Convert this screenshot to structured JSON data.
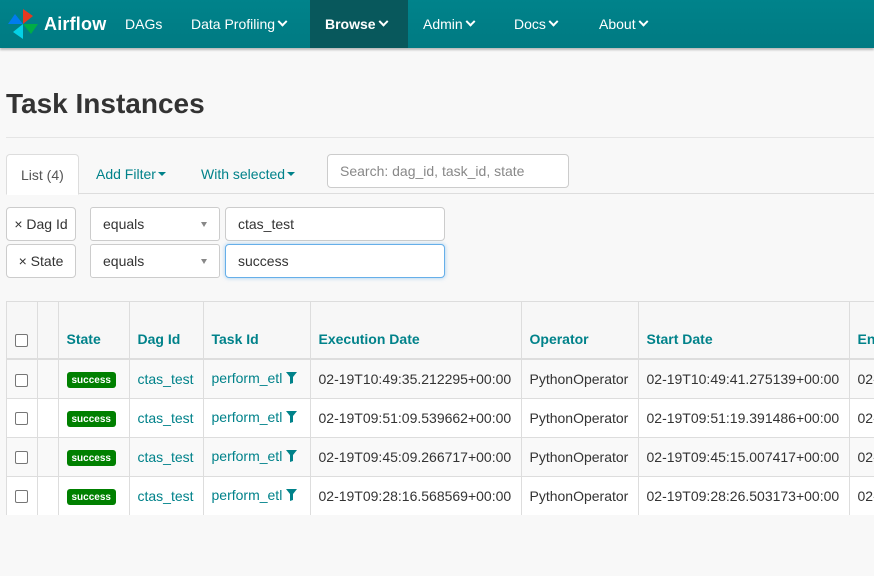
{
  "navbar": {
    "brand": "Airflow",
    "items": [
      {
        "label": "DAGs",
        "dropdown": false,
        "active": false
      },
      {
        "label": "Data Profiling",
        "dropdown": true,
        "active": false
      },
      {
        "label": "Browse",
        "dropdown": true,
        "active": true
      },
      {
        "label": "Admin",
        "dropdown": true,
        "active": false
      },
      {
        "label": "Docs",
        "dropdown": true,
        "active": false
      },
      {
        "label": "About",
        "dropdown": true,
        "active": false
      }
    ]
  },
  "page": {
    "title": "Task Instances"
  },
  "tabs": {
    "list": "List (4)",
    "add_filter": "Add Filter",
    "with_selected": "With selected"
  },
  "search": {
    "placeholder": "Search: dag_id, task_id, state",
    "value": ""
  },
  "filters": [
    {
      "remove_label": "× Dag Id",
      "operator": "equals",
      "value": "ctas_test"
    },
    {
      "remove_label": "× State",
      "operator": "equals",
      "value": "success"
    }
  ],
  "table": {
    "columns": [
      "State",
      "Dag Id",
      "Task Id",
      "Execution Date",
      "Operator",
      "Start Date",
      "En"
    ],
    "rows": [
      {
        "state": "success",
        "dag_id": "ctas_test",
        "task_id": "perform_etl",
        "execution_date": "02-19T10:49:35.212295+00:00",
        "operator": "PythonOperator",
        "start_date": "02-19T10:49:41.275139+00:00",
        "end_date": "02-"
      },
      {
        "state": "success",
        "dag_id": "ctas_test",
        "task_id": "perform_etl",
        "execution_date": "02-19T09:51:09.539662+00:00",
        "operator": "PythonOperator",
        "start_date": "02-19T09:51:19.391486+00:00",
        "end_date": "02-"
      },
      {
        "state": "success",
        "dag_id": "ctas_test",
        "task_id": "perform_etl",
        "execution_date": "02-19T09:45:09.266717+00:00",
        "operator": "PythonOperator",
        "start_date": "02-19T09:45:15.007417+00:00",
        "end_date": "02-"
      },
      {
        "state": "success",
        "dag_id": "ctas_test",
        "task_id": "perform_etl",
        "execution_date": "02-19T09:28:16.568569+00:00",
        "operator": "PythonOperator",
        "start_date": "02-19T09:28:26.503173+00:00",
        "end_date": "02-"
      }
    ]
  },
  "colors": {
    "navbar": "#00838b",
    "navbar_active": "#08585c",
    "link": "#00828a",
    "success_badge": "#008000"
  },
  "icons": {
    "brand": "airflow-pinwheel-icon",
    "caret": "chevron-down-icon",
    "filter": "funnel-icon"
  }
}
